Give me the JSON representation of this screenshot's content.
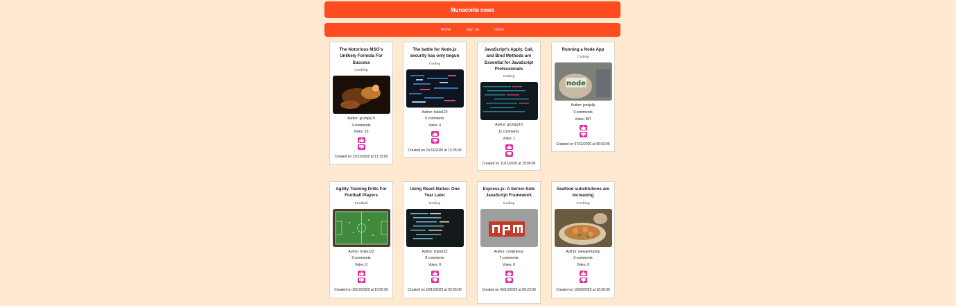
{
  "header": {
    "title": "Munaciella news"
  },
  "nav": {
    "home": "Home",
    "signup": "Sign up",
    "users": "Users"
  },
  "colors": {
    "accent": "#fe4b20",
    "vote": "#e0289e",
    "background": "#ffe9d0"
  },
  "articles": [
    {
      "title": "The Notorious MSG's Unlikely Formula For Success",
      "topic": "Cooking",
      "author": "Author: grumpy19",
      "comments": "4 comments",
      "votes": "Votes: 10",
      "created": "Created on 22/11/2020 at 11:13:00"
    },
    {
      "title": "The battle for Node.js security has only begun",
      "topic": "Coding",
      "author": "Author: tickle122",
      "comments": "0 comments",
      "votes": "Votes: 0",
      "created": "Created on 15/11/2020 at 13:25:00"
    },
    {
      "title": "JavaScript's Apply, Call, and Bind Methods are Essential for JavaScript Professionals",
      "topic": "Coding",
      "author": "Author: grumpy19",
      "comments": "11 comments",
      "votes": "Votes: 1",
      "created": "Created on 11/11/2020 at 15:09:00"
    },
    {
      "title": "Running a Node App",
      "topic": "Coding",
      "author": "Author: jessjelly",
      "comments": "9 comments",
      "votes": "Votes: 587",
      "created": "Created on 07/11/2020 at 06:03:00"
    },
    {
      "title": "Agility Training Drills For Football Players",
      "topic": "Football",
      "author": "Author: tickle122",
      "comments": "6 comments",
      "votes": "Votes: 0",
      "created": "Created on 26/10/2020 at 10:05:00"
    },
    {
      "title": "Using React Native: One Year Later",
      "topic": "Coding",
      "author": "Author: tickle122",
      "comments": "8 comments",
      "votes": "Votes: 0",
      "created": "Created on 18/10/2020 at 02:26:00"
    },
    {
      "title": "Express.js: A Server-Side JavaScript Framework",
      "topic": "Coding",
      "author": "Author: cooljmessy",
      "comments": "7 comments",
      "votes": "Votes: 0",
      "created": "Created on 06/10/2020 at 00:23:00"
    },
    {
      "title": "Seafood substitutions are increasing",
      "topic": "Cooking",
      "author": "Author: weegembump",
      "comments": "6 comments",
      "votes": "Votes: 0",
      "created": "Created on 16/09/2020 at 18:26:00"
    }
  ],
  "images": {
    "node_logo_text": "node"
  }
}
